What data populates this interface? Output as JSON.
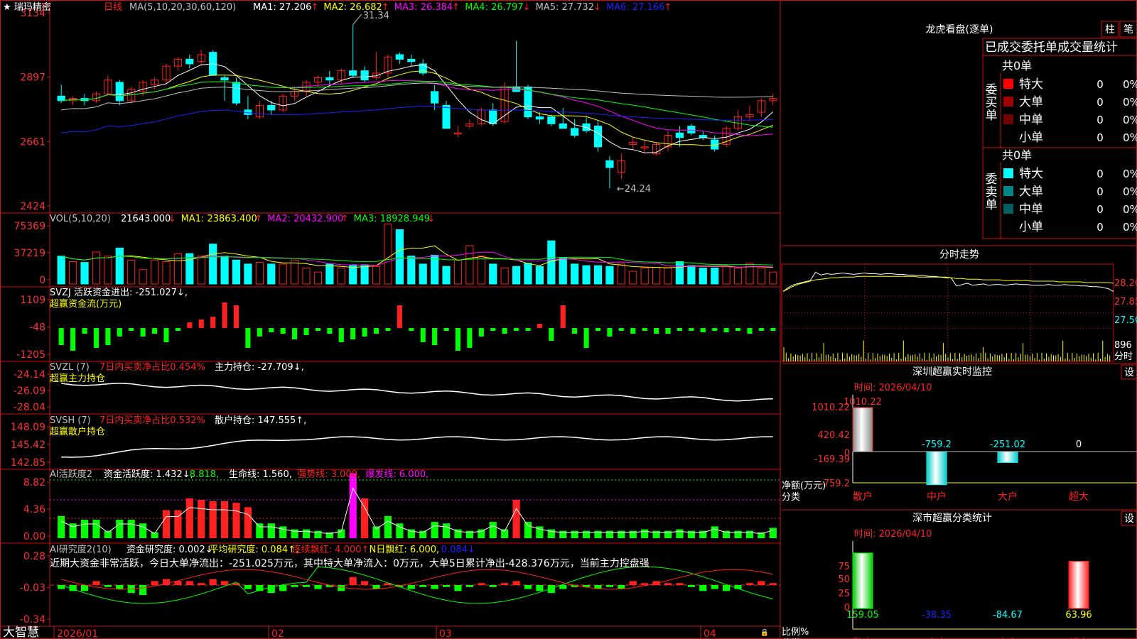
{
  "stock": {
    "star": "★",
    "name": "瑞玛精密",
    "period": "日线"
  },
  "colors": {
    "up": "#ff2020",
    "down": "#00ffff",
    "grid": "#d01010",
    "axis": "#d01010",
    "text": "#c0c0c0",
    "yellow": "#ffff00",
    "magenta": "#ff00ff",
    "green": "#00ff00",
    "white": "#ffffff",
    "blue": "#2020ff",
    "gray": "#c0c0c0"
  },
  "main_header": {
    "ma_label": "MA(5,10,20,30,60,120)",
    "items": [
      {
        "label": "MA1: 27.206",
        "arrow": "↑",
        "color": "#ffffff"
      },
      {
        "label": "MA2: 26.682",
        "arrow": "↑",
        "color": "#ffff00"
      },
      {
        "label": "MA3: 26.384",
        "arrow": "↑",
        "color": "#ff00ff"
      },
      {
        "label": "MA4: 26.797",
        "arrow": "↓",
        "color": "#00ff00"
      },
      {
        "label": "MA5: 27.732",
        "arrow": "↓",
        "color": "#c0c0c0"
      },
      {
        "label": "MA6: 27.166",
        "arrow": "↑",
        "color": "#2020ff"
      }
    ]
  },
  "vol_header": {
    "label": "VOL(5,10,20)",
    "items": [
      {
        "label": "21643.000",
        "arrow": "↓",
        "color": "#ffffff"
      },
      {
        "label": "MA1: 23863.400",
        "arrow": "↑",
        "color": "#ffff00"
      },
      {
        "label": "MA2: 20432.900",
        "arrow": "↑",
        "color": "#ff00ff"
      },
      {
        "label": "MA3: 18928.949",
        "arrow": "↓",
        "color": "#00ff00"
      }
    ]
  },
  "svzj": {
    "line1": "SVZJ  活跃资金进出: -251.027↓,",
    "line2": "超赢资金流(万元)"
  },
  "svzl": {
    "prefix": "SVZL (7)",
    "ratio": "7日内买卖净占比0.454%",
    "value": "主力持仓: -27.709↓,",
    "line2": "超赢主力持仓"
  },
  "svsh": {
    "prefix": "SVSH (7)",
    "ratio": "7日内买卖净占比0.532%",
    "value": "散户持仓: 147.555↑,",
    "line2": "超赢散户持仓"
  },
  "ai1": {
    "label": "AI活跃度2",
    "items": [
      {
        "label": "资金活跃度: 1.432↓,",
        "color": "#ffffff"
      },
      {
        "label": "8.818,",
        "color": "#00ff00"
      },
      {
        "label": "生命线: 1.560,",
        "color": "#ffffff"
      },
      {
        "label": "强势线: 3.000,",
        "color": "#ff2020"
      },
      {
        "label": "爆发线: 6.000,",
        "color": "#ff00ff"
      }
    ]
  },
  "ai2": {
    "label": "AI研究度2(10)",
    "items": [
      {
        "label": "资金研究度: 0.002↓,",
        "color": "#ffffff"
      },
      {
        "label": "平均研究度: 0.084↑,",
        "color": "#ffff00"
      },
      {
        "label": "连续飘红: 4.000↑,",
        "color": "#ff2020"
      },
      {
        "label": "N日飘红: 6.000,",
        "color": "#ffff00"
      },
      {
        "label": "0.084↓",
        "color": "#2020ff"
      }
    ],
    "comment": "近期大资金非常活跃，今日大单净流出：-251.025万元，其中特大单净流入：0万元，大单5日累计净出-428.376万元，当前主力控盘强"
  },
  "yticks": {
    "main": [
      "3134",
      "2897",
      "2661",
      "2424"
    ],
    "vol": [
      "75369",
      "37219",
      "0"
    ],
    "svzj": [
      "1109",
      "-48",
      "-1205"
    ],
    "svzl": [
      "-24.14",
      "-26.09",
      "-28.04"
    ],
    "svsh": [
      "148.09",
      "145.42",
      "142.85"
    ],
    "ai1": [
      "8.82",
      "4.36",
      "0.00"
    ],
    "ai2": [
      "0.28",
      "-0.03",
      "-0.34"
    ]
  },
  "xticks": [
    "2026/01",
    "02",
    "03",
    "04"
  ],
  "annotations": {
    "high": "31.34",
    "low": "24.24"
  },
  "brand": "大智慧",
  "lhb": {
    "title": "龙虎看盘(逐单)",
    "btn1": "柱",
    "btn2": "笔",
    "tab_title": "已成交委托单成交量统计",
    "buy": {
      "label": "委买单",
      "total": "共0单",
      "rows": [
        {
          "name": "特大",
          "v": "0",
          "pct": "0%",
          "color": "#ff0000"
        },
        {
          "name": "大单",
          "v": "0",
          "pct": "0%",
          "color": "#a00000"
        },
        {
          "name": "中单",
          "v": "0",
          "pct": "0%",
          "color": "#700000"
        },
        {
          "name": "小单",
          "v": "0",
          "pct": "0%",
          "color": ""
        }
      ]
    },
    "sell": {
      "label": "委卖单",
      "total": "共0单",
      "rows": [
        {
          "name": "特大",
          "v": "0",
          "pct": "0%",
          "color": "#00ffff"
        },
        {
          "name": "大单",
          "v": "0",
          "pct": "0%",
          "color": "#008888"
        },
        {
          "name": "中单",
          "v": "0",
          "pct": "0%",
          "color": "#006060"
        },
        {
          "name": "小单",
          "v": "0",
          "pct": "0%",
          "color": ""
        }
      ]
    }
  },
  "intraday": {
    "title": "分时走势",
    "ticks": [
      "28.20",
      "27.85",
      "27.50"
    ],
    "vol_tick": "896",
    "vol_label": "分时",
    "price": [
      28.02,
      28.08,
      28.12,
      28.14,
      28.16,
      28.18,
      28.3,
      28.26,
      28.28,
      28.27,
      28.28,
      28.29,
      28.28,
      28.27,
      28.28,
      28.29,
      28.28,
      28.28,
      28.27,
      28.28,
      28.28,
      28.27,
      28.27,
      28.26,
      28.26,
      28.25,
      28.25,
      28.24,
      28.24,
      28.23,
      28.23,
      28.22,
      28.1,
      28.12,
      28.14,
      28.11,
      28.12,
      28.13,
      28.11,
      28.12,
      28.12,
      28.11,
      28.12,
      28.13,
      28.12,
      28.12,
      28.11,
      28.11,
      28.11,
      28.12,
      28.11,
      28.11,
      28.12,
      28.11,
      28.11,
      28.1,
      28.1,
      28.09,
      28.09,
      28.08,
      28.06,
      28.02
    ],
    "avg": [
      28.02,
      28.06,
      28.1,
      28.13,
      28.15,
      28.17,
      28.19,
      28.2,
      28.21,
      28.22,
      28.22,
      28.23,
      28.23,
      28.23,
      28.24,
      28.24,
      28.24,
      28.24,
      28.24,
      28.24,
      28.24,
      28.24,
      28.24,
      28.24,
      28.24,
      28.23,
      28.23,
      28.23,
      28.23,
      28.23,
      28.22,
      28.22,
      28.21,
      28.21,
      28.2,
      28.2,
      28.2,
      28.19,
      28.19,
      28.19,
      28.19,
      28.18,
      28.18,
      28.18,
      28.18,
      28.18,
      28.17,
      28.17,
      28.17,
      28.17,
      28.17,
      28.16,
      28.16,
      28.16,
      28.16,
      28.16,
      28.15,
      28.15,
      28.15,
      28.15,
      28.15,
      28.14
    ]
  },
  "sz_monitor": {
    "title": "深圳超赢实时监控",
    "btn": "设",
    "time": "时间: 2026/04/10",
    "yticks": [
      "1010.22",
      "420.42",
      "0",
      "-169.39",
      "-759.2"
    ],
    "ylabel": "净额(万元)",
    "xlabel": "分类",
    "bars": [
      {
        "cat": "散户",
        "v": 1010.22,
        "label": "1010.22",
        "color": "#ff2020"
      },
      {
        "cat": "中户",
        "v": -759.2,
        "label": "-759.2",
        "color": "#00ffff"
      },
      {
        "cat": "大户",
        "v": -251.02,
        "label": "-251.02",
        "color": "#00ffff"
      },
      {
        "cat": "超大",
        "v": 0,
        "label": "0",
        "color": "#ffffff"
      }
    ]
  },
  "sz_stats": {
    "title": "深市超赢分类统计",
    "btn": "设",
    "time": "时间: 2026/04/10",
    "yticks": [
      "75",
      "50",
      "25",
      "0"
    ],
    "ylabel": "比例%",
    "xlabel": "分类",
    "bars": [
      {
        "cat": "散户",
        "v": 159.05,
        "label": "159.05",
        "color": "#00ff00"
      },
      {
        "cat": "中户",
        "v": -38.35,
        "label": "-38.35",
        "color": "#2020ff"
      },
      {
        "cat": "大户",
        "v": -84.67,
        "label": "-84.67",
        "color": "#00ffff"
      },
      {
        "cat": "超大",
        "v": 63.96,
        "label": "63.96",
        "color": "#ffff00"
      }
    ]
  },
  "chart_data": {
    "type": "bar",
    "candles": [
      [
        28.2,
        28.7,
        27.9,
        28.0
      ],
      [
        28.0,
        28.2,
        27.8,
        28.1
      ],
      [
        28.1,
        28.3,
        27.8,
        28.0
      ],
      [
        28.0,
        28.4,
        27.9,
        28.3
      ],
      [
        28.3,
        29.1,
        28.2,
        28.9
      ],
      [
        28.8,
        28.9,
        27.8,
        28.0
      ],
      [
        28.0,
        28.6,
        27.9,
        28.5
      ],
      [
        28.4,
        28.9,
        28.2,
        28.8
      ],
      [
        28.7,
        29.0,
        28.5,
        28.9
      ],
      [
        28.9,
        29.6,
        28.7,
        29.5
      ],
      [
        29.5,
        29.9,
        29.3,
        29.8
      ],
      [
        29.8,
        30.0,
        29.4,
        29.6
      ],
      [
        29.7,
        30.2,
        29.5,
        30.0
      ],
      [
        30.1,
        30.2,
        29.1,
        29.1
      ],
      [
        29.0,
        29.1,
        28.0,
        28.9
      ],
      [
        28.8,
        29.0,
        27.8,
        27.9
      ],
      [
        27.6,
        28.2,
        27.2,
        27.4
      ],
      [
        27.3,
        28.0,
        27.2,
        27.8
      ],
      [
        27.8,
        28.0,
        27.4,
        27.6
      ],
      [
        27.6,
        28.3,
        27.5,
        28.2
      ],
      [
        28.2,
        28.6,
        28.0,
        28.4
      ],
      [
        28.4,
        28.9,
        28.2,
        28.8
      ],
      [
        28.8,
        29.1,
        28.6,
        29.0
      ],
      [
        29.0,
        29.3,
        28.7,
        28.9
      ],
      [
        28.9,
        29.4,
        28.7,
        29.3
      ],
      [
        29.3,
        31.3,
        29.0,
        29.1
      ],
      [
        29.3,
        29.5,
        28.8,
        28.9
      ],
      [
        29.0,
        30.1,
        28.9,
        29.2
      ],
      [
        29.2,
        30.0,
        29.0,
        29.9
      ],
      [
        30.0,
        30.1,
        29.6,
        29.8
      ],
      [
        29.8,
        30.0,
        29.5,
        29.7
      ],
      [
        29.6,
        29.8,
        29.1,
        29.2
      ],
      [
        28.4,
        28.7,
        27.6,
        27.9
      ],
      [
        27.8,
        28.0,
        26.8,
        26.8
      ],
      [
        26.6,
        26.9,
        26.4,
        26.6
      ],
      [
        26.9,
        27.2,
        26.8,
        27.0
      ],
      [
        27.0,
        27.7,
        26.9,
        27.6
      ],
      [
        27.6,
        27.9,
        26.9,
        27.0
      ],
      [
        27.1,
        28.8,
        27.0,
        28.6
      ],
      [
        28.6,
        30.6,
        28.4,
        28.4
      ],
      [
        28.6,
        28.7,
        27.2,
        27.3
      ],
      [
        27.3,
        27.5,
        27.0,
        27.2
      ],
      [
        27.3,
        27.4,
        26.9,
        27.0
      ],
      [
        27.0,
        27.7,
        26.8,
        26.8
      ],
      [
        26.8,
        27.2,
        26.4,
        26.5
      ],
      [
        27.0,
        27.3,
        26.6,
        26.7
      ],
      [
        26.9,
        27.1,
        25.8,
        26.0
      ],
      [
        25.4,
        25.6,
        24.2,
        25.1
      ],
      [
        24.9,
        25.7,
        24.6,
        25.4
      ],
      [
        26.1,
        26.4,
        25.9,
        26.2
      ],
      [
        26.0,
        26.3,
        25.7,
        26.0
      ],
      [
        25.7,
        26.2,
        25.6,
        26.1
      ],
      [
        26.0,
        26.7,
        25.8,
        26.5
      ],
      [
        26.6,
        26.9,
        26.0,
        26.4
      ],
      [
        26.9,
        27.0,
        26.5,
        26.6
      ],
      [
        26.5,
        26.7,
        26.3,
        26.4
      ],
      [
        26.3,
        26.5,
        25.8,
        25.9
      ],
      [
        26.1,
        26.9,
        26.0,
        26.8
      ],
      [
        26.8,
        27.6,
        26.7,
        27.3
      ],
      [
        27.3,
        27.8,
        27.1,
        27.4
      ],
      [
        27.5,
        28.1,
        27.3,
        28.0
      ],
      [
        28.0,
        28.3,
        27.8,
        28.1
      ]
    ],
    "vol": [
      35000,
      28000,
      27000,
      40000,
      35000,
      45000,
      30000,
      18000,
      30000,
      28000,
      38000,
      38000,
      35000,
      50000,
      35000,
      30000,
      25000,
      27000,
      25000,
      25000,
      30000,
      20000,
      15000,
      25000,
      20000,
      24000,
      24000,
      22000,
      75000,
      68000,
      35000,
      25000,
      36000,
      22000,
      30000,
      48000,
      35000,
      25000,
      20000,
      22000,
      26000,
      22000,
      54000,
      33000,
      25000,
      23000,
      23000,
      22000,
      25000,
      16000,
      20000,
      21000,
      20000,
      28000,
      23000,
      20000,
      20000,
      22000,
      20000,
      26000,
      20000,
      15000,
      13000,
      28000,
      20000,
      23000
    ],
    "svzj": [
      -600,
      -800,
      -200,
      -700,
      -600,
      -300,
      -100,
      -300,
      -200,
      -500,
      -100,
      200,
      300,
      400,
      900,
      800,
      -700,
      -300,
      -150,
      -200,
      -400,
      -250,
      -100,
      -200,
      -500,
      -400,
      -300,
      -200,
      -100,
      800,
      -100,
      -500,
      -600,
      -100,
      -800,
      -700,
      -300,
      -100,
      -200,
      -100,
      -100,
      150,
      -450,
      800,
      -200,
      -700,
      -100,
      -300,
      -100,
      -200,
      -100,
      -200,
      -200,
      -100,
      -100,
      -150,
      -100,
      -150,
      -100,
      -200,
      -100,
      -100,
      -100,
      -150,
      -100,
      -200,
      -100,
      -200
    ]
  }
}
